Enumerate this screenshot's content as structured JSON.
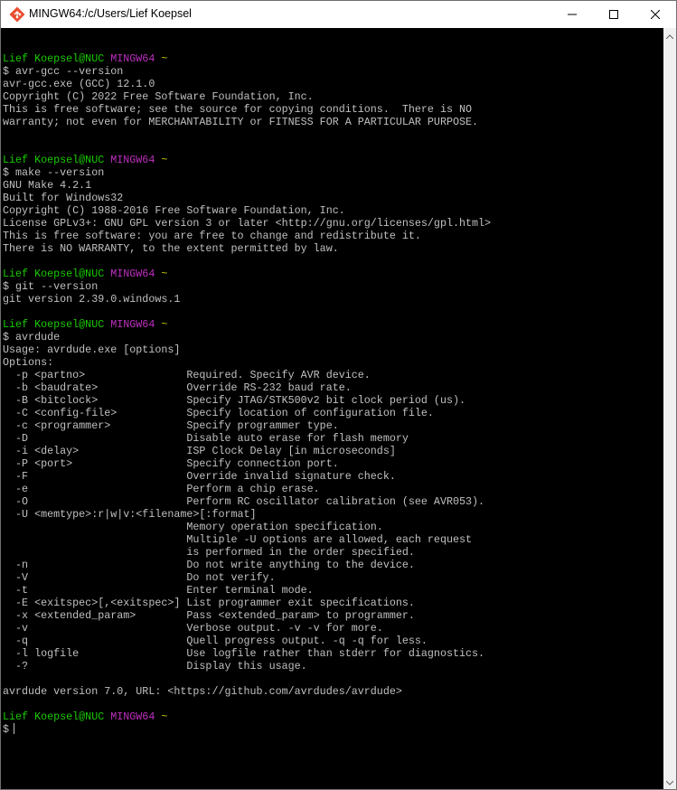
{
  "window": {
    "title": "MINGW64:/c/Users/Lief Koepsel",
    "icon": "git-bash-icon",
    "buttons": {
      "minimize": "minimize-icon",
      "maximize": "maximize-icon",
      "close": "close-icon"
    }
  },
  "colors": {
    "user": "#19cb00",
    "system": "#bd2fbe",
    "path": "#c7c400",
    "text": "#c0c0c0",
    "background": "#000000"
  },
  "terminal": {
    "lines": [
      {
        "type": "blank"
      },
      {
        "type": "prompt",
        "user": "Lief Koepsel@NUC",
        "system": "MINGW64",
        "path": "~"
      },
      {
        "type": "cmd",
        "text": "$ avr-gcc --version"
      },
      {
        "type": "out",
        "text": "avr-gcc.exe (GCC) 12.1.0"
      },
      {
        "type": "out",
        "text": "Copyright (C) 2022 Free Software Foundation, Inc."
      },
      {
        "type": "out",
        "text": "This is free software; see the source for copying conditions.  There is NO"
      },
      {
        "type": "out",
        "text": "warranty; not even for MERCHANTABILITY or FITNESS FOR A PARTICULAR PURPOSE."
      },
      {
        "type": "blank"
      },
      {
        "type": "blank"
      },
      {
        "type": "prompt",
        "user": "Lief Koepsel@NUC",
        "system": "MINGW64",
        "path": "~"
      },
      {
        "type": "cmd",
        "text": "$ make --version"
      },
      {
        "type": "out",
        "text": "GNU Make 4.2.1"
      },
      {
        "type": "out",
        "text": "Built for Windows32"
      },
      {
        "type": "out",
        "text": "Copyright (C) 1988-2016 Free Software Foundation, Inc."
      },
      {
        "type": "out",
        "text": "License GPLv3+: GNU GPL version 3 or later <http://gnu.org/licenses/gpl.html>"
      },
      {
        "type": "out",
        "text": "This is free software: you are free to change and redistribute it."
      },
      {
        "type": "out",
        "text": "There is NO WARRANTY, to the extent permitted by law."
      },
      {
        "type": "blank"
      },
      {
        "type": "prompt",
        "user": "Lief Koepsel@NUC",
        "system": "MINGW64",
        "path": "~"
      },
      {
        "type": "cmd",
        "text": "$ git --version"
      },
      {
        "type": "out",
        "text": "git version 2.39.0.windows.1"
      },
      {
        "type": "blank"
      },
      {
        "type": "prompt",
        "user": "Lief Koepsel@NUC",
        "system": "MINGW64",
        "path": "~"
      },
      {
        "type": "cmd",
        "text": "$ avrdude"
      },
      {
        "type": "out",
        "text": "Usage: avrdude.exe [options]"
      },
      {
        "type": "out",
        "text": "Options:"
      },
      {
        "type": "out",
        "text": "  -p <partno>                Required. Specify AVR device."
      },
      {
        "type": "out",
        "text": "  -b <baudrate>              Override RS-232 baud rate."
      },
      {
        "type": "out",
        "text": "  -B <bitclock>              Specify JTAG/STK500v2 bit clock period (us)."
      },
      {
        "type": "out",
        "text": "  -C <config-file>           Specify location of configuration file."
      },
      {
        "type": "out",
        "text": "  -c <programmer>            Specify programmer type."
      },
      {
        "type": "out",
        "text": "  -D                         Disable auto erase for flash memory"
      },
      {
        "type": "out",
        "text": "  -i <delay>                 ISP Clock Delay [in microseconds]"
      },
      {
        "type": "out",
        "text": "  -P <port>                  Specify connection port."
      },
      {
        "type": "out",
        "text": "  -F                         Override invalid signature check."
      },
      {
        "type": "out",
        "text": "  -e                         Perform a chip erase."
      },
      {
        "type": "out",
        "text": "  -O                         Perform RC oscillator calibration (see AVR053)."
      },
      {
        "type": "out",
        "text": "  -U <memtype>:r|w|v:<filename>[:format]"
      },
      {
        "type": "out",
        "text": "                             Memory operation specification."
      },
      {
        "type": "out",
        "text": "                             Multiple -U options are allowed, each request"
      },
      {
        "type": "out",
        "text": "                             is performed in the order specified."
      },
      {
        "type": "out",
        "text": "  -n                         Do not write anything to the device."
      },
      {
        "type": "out",
        "text": "  -V                         Do not verify."
      },
      {
        "type": "out",
        "text": "  -t                         Enter terminal mode."
      },
      {
        "type": "out",
        "text": "  -E <exitspec>[,<exitspec>] List programmer exit specifications."
      },
      {
        "type": "out",
        "text": "  -x <extended_param>        Pass <extended_param> to programmer."
      },
      {
        "type": "out",
        "text": "  -v                         Verbose output. -v -v for more."
      },
      {
        "type": "out",
        "text": "  -q                         Quell progress output. -q -q for less."
      },
      {
        "type": "out",
        "text": "  -l logfile                 Use logfile rather than stderr for diagnostics."
      },
      {
        "type": "out",
        "text": "  -?                         Display this usage."
      },
      {
        "type": "blank"
      },
      {
        "type": "out",
        "text": "avrdude version 7.0, URL: <https://github.com/avrdudes/avrdude>"
      },
      {
        "type": "blank"
      },
      {
        "type": "prompt",
        "user": "Lief Koepsel@NUC",
        "system": "MINGW64",
        "path": "~"
      },
      {
        "type": "input",
        "text": "$"
      }
    ]
  }
}
